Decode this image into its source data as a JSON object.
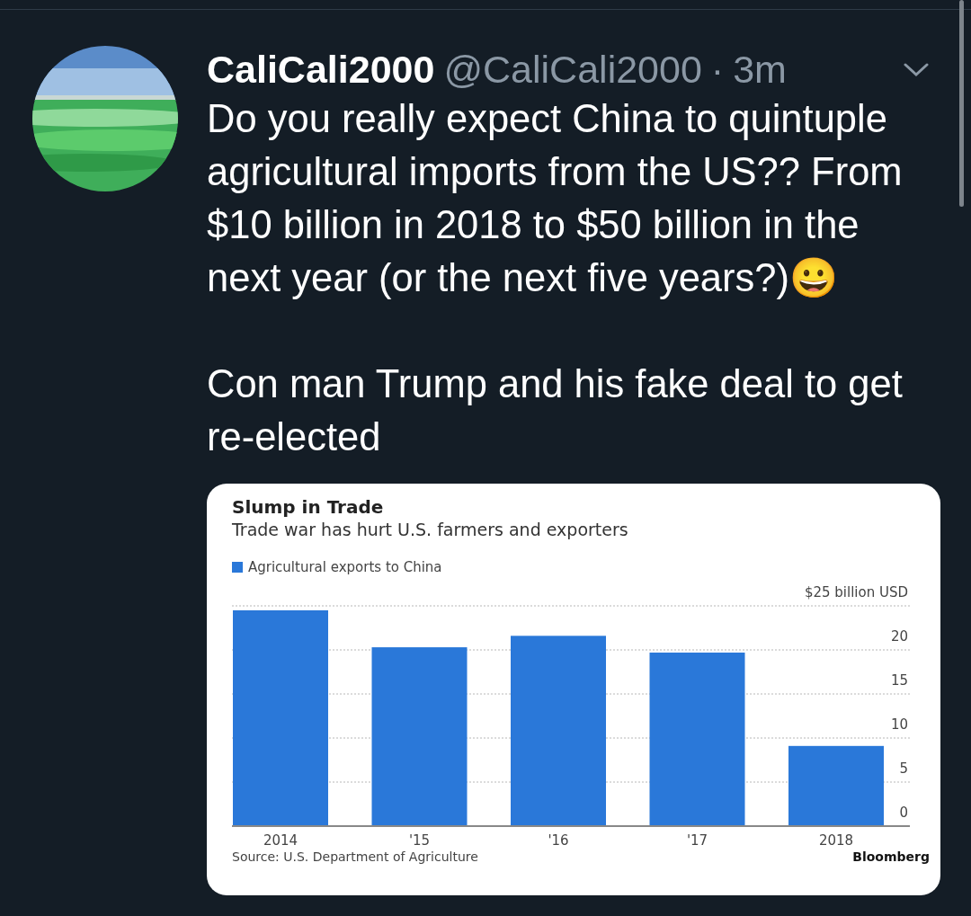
{
  "tweet": {
    "author": {
      "name": "CaliCali2000",
      "handle": "@CaliCali2000",
      "separator": "·",
      "time": "3m"
    },
    "paragraphs": [
      {
        "text": "Do you really expect China to quintuple agricultural imports from the US?? From $10 billion in 2018 to $50 billion in the next year (or the next five years?)😀"
      },
      {
        "text": "Con man Trump and his fake deal to get re-elected"
      }
    ],
    "media": {
      "subtitle": "Trade war has hurt U.S. farmers and exporters",
      "source": "Source: U.S. Department of Agriculture",
      "credit": "Bloomberg",
      "chart_data": {
        "type": "bar",
        "title": "Slump in Trade",
        "categories": [
          "2014",
          "'15",
          "'16",
          "'17",
          "2018"
        ],
        "series": [
          {
            "name": "Agricultural exports to China",
            "color": "#2a78d9",
            "values": [
              24.5,
              20.3,
              21.6,
              19.7,
              9.1
            ]
          }
        ],
        "ylim": [
          0,
          25
        ],
        "grid": true,
        "yticks": [
          0,
          5,
          10,
          15,
          20,
          {
            "value": 25,
            "label": "$25 billion USD"
          }
        ]
      }
    }
  }
}
